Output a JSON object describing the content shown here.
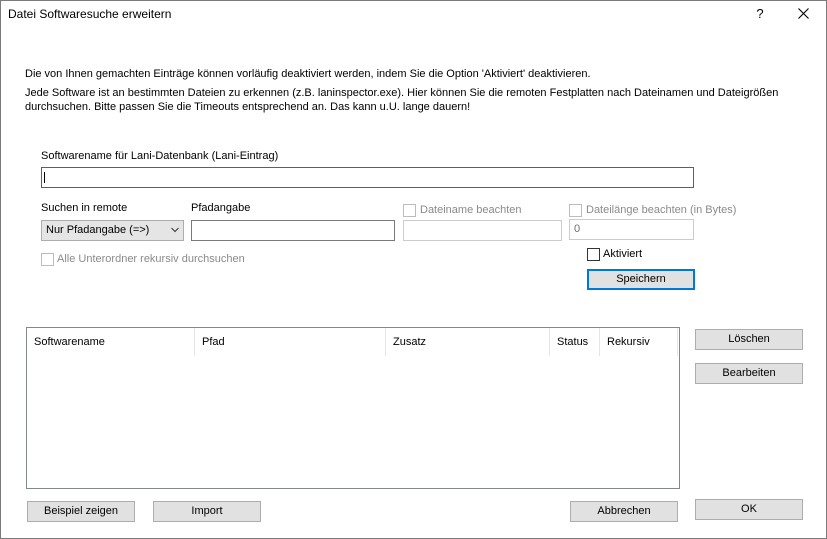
{
  "window": {
    "title": "Datei Softwaresuche erweitern",
    "help_glyph": "?",
    "close_glyph": "✕"
  },
  "info": {
    "line1": "Die von Ihnen gemachten Einträge können vorläufig deaktiviert werden, indem Sie die Option 'Aktiviert' deaktivieren.",
    "line2": "Jede Software ist an bestimmten Dateien zu erkennen (z.B. laninspector.exe). Hier können Sie die remoten Festplatten nach Dateinamen und Dateigrößen",
    "line3": "durchsuchen. Bitte passen Sie die Timeouts entsprechend an. Das kann u.U. lange dauern!"
  },
  "form": {
    "softwarename_label": "Softwarename für Lani-Datenbank (Lani-Eintrag)",
    "softwarename_value": "",
    "suchen_label": "Suchen in remote",
    "suchen_value": "Nur Pfadangabe (=>)",
    "pfad_label": "Pfadangabe",
    "pfad_value": "",
    "dateiname_label": "Dateiname beachten",
    "dateiname_value": "",
    "dateilaenge_label": "Dateilänge beachten (in Bytes)",
    "dateilaenge_value": "0",
    "rekursiv_label": "Alle Unterordner rekursiv durchsuchen",
    "aktiviert_label": "Aktiviert",
    "speichern_label": "Speichern"
  },
  "table": {
    "columns": [
      "Softwarename",
      "Pfad",
      "Zusatz",
      "Status",
      "Rekursiv"
    ],
    "rows": []
  },
  "buttons": {
    "loeschen": "Löschen",
    "bearbeiten": "Bearbeiten",
    "beispiel": "Beispiel zeigen",
    "import": "Import",
    "abbrechen": "Abbrechen",
    "ok": "OK"
  },
  "colors": {
    "focus_border": "#0078d7",
    "button_face": "#e1e1e1",
    "disabled_text": "#8a8a8a"
  }
}
